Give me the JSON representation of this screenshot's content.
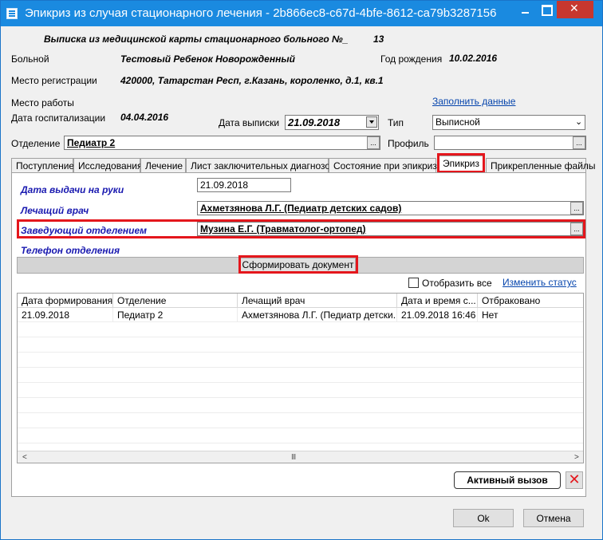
{
  "window": {
    "title": "Эпикриз из случая стационарного лечения - 2b866ec8-c67d-4bfe-8612-ca79b3287156",
    "minimize": "",
    "maximize": "",
    "close": ""
  },
  "header": {
    "extract_title": "Выписка из медицинской карты стационарного больного №_",
    "card_number": "13",
    "patient_label": "Больной",
    "patient_value": "Тестовый Ребенок Новорожденный",
    "birth_year_label": "Год рождения",
    "birth_year_value": "10.02.2016",
    "registration_label": "Место регистрации",
    "registration_value": "420000, Татарстан Респ, г.Казань, короленко, д.1, кв.1",
    "work_label": "Место работы",
    "fill_data_link": "Заполнить данные",
    "admission_label": "Дата госпитализации",
    "admission_value": "04.04.2016",
    "discharge_label": "Дата выписки",
    "discharge_value": "21.09.2018",
    "type_label": "Тип",
    "type_value": "Выписной",
    "department_label": "Отделение",
    "department_value": "Педиатр 2",
    "profile_label": "Профиль",
    "profile_value": "",
    "dots": "..."
  },
  "tabs": [
    {
      "label": "Поступление"
    },
    {
      "label": "Исследования"
    },
    {
      "label": "Лечение"
    },
    {
      "label": "Лист заключительных диагнозов"
    },
    {
      "label": "Состояние при эпикризе"
    },
    {
      "label": "Эпикриз",
      "active": true
    },
    {
      "label": "Прикрепленные файлы"
    }
  ],
  "epicrisis": {
    "issue_date_label": "Дата выдачи на руки",
    "issue_date_value": "21.09.2018",
    "doctor_label": "Лечащий врач",
    "doctor_value": "Ахметзянова Л.Г. (Педиатр детских садов)",
    "head_label": "Заведующий отделением",
    "head_value": "Музина Е.Г. (Травматолог-ортопед)",
    "phone_label": "Телефон отделения",
    "generate_button": "Сформировать документ",
    "show_all_label": "Отобразить все",
    "change_status_link": "Изменить статус"
  },
  "grid": {
    "columns": [
      "Дата формирования",
      "Отделение",
      "Лечащий врач",
      "Дата и время с...",
      "Отбраковано"
    ],
    "rows": [
      [
        "21.09.2018",
        "Педиатр 2",
        "Ахметзянова Л.Г. (Педиатр детски...",
        "21.09.2018 16:46",
        "Нет"
      ]
    ],
    "scroll_left": "<",
    "scroll_right": ">",
    "scroll_thumb": "III"
  },
  "footer": {
    "active_call_button": "Активный вызов",
    "delete_icon": "✕",
    "ok_button": "Ok",
    "cancel_button": "Отмена"
  },
  "colors": {
    "title_bar": "#1a8ae0",
    "highlight": "#e4161c",
    "label_blue": "#1a1ab0",
    "link_blue": "#0645ad"
  }
}
